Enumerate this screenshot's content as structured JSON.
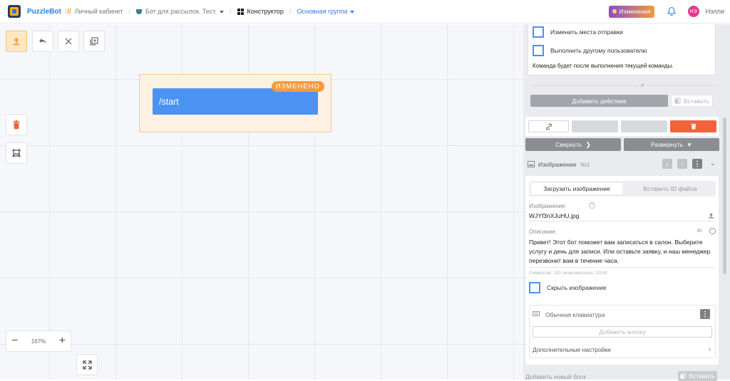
{
  "header": {
    "brand": "PuzzleBot",
    "brand_sep": "://",
    "crumb_cabinet": "Личный кабинет",
    "crumb_bot": "Бот для рассылок. Тест.",
    "crumb_builder": "Конструктор",
    "crumb_group": "Основная группа",
    "changes_label": "Изменения",
    "avatar_initials": "НЭ",
    "user_name": "Нэлли"
  },
  "canvas": {
    "zoom": "167%",
    "block_title": "/start",
    "block_badge": "ИЗМЕНЕНО"
  },
  "panel": {
    "chk_change_place": "Изменить места отправки",
    "chk_exec_other": "Выполнить другому пользователю",
    "cmd_note": "Команда будет после выполнения текущей команды.",
    "and_label": "и",
    "add_action": "Добавить действие",
    "insert_label": "Вставить",
    "collapse": "Свернуть",
    "expand": "Развернуть",
    "image_title": "Изображение",
    "image_num": "№1",
    "tab_upload": "Загрузить изображение",
    "tab_file_id": "Вставить ID файла",
    "image_label": "Изображение:",
    "image_file": "WJYf3nXJuHU.jpg",
    "desc_label": "Описание:",
    "desc_text": "Привет! Этот бот поможет вам записаться в салон. Выберите услугу и день для записи. Или оставьте заявку, и наш менеджер перезвонит вам в течение часа.",
    "char_count": "Символов: 150 (максимально: 1024)",
    "hide_image": "Скрыть изображение",
    "keyboard_label": "Обычная клавиатура",
    "add_button": "Добавить кнопку",
    "extra_settings": "Дополнительные настройки",
    "add_block": "Добавить новый блок",
    "insert_bottom": "Вставить"
  },
  "colors": {
    "accent_blue": "#4a93f3",
    "changed_orange": "#f79a3e",
    "delete_red": "#f4623a"
  }
}
